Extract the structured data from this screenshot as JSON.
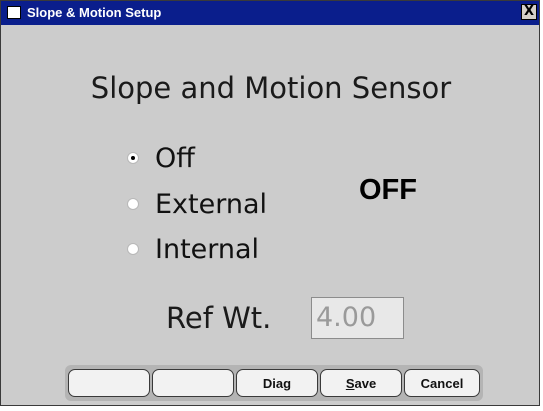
{
  "window": {
    "title": "Slope & Motion Setup",
    "close_label": "X"
  },
  "heading": "Slope and Motion Sensor",
  "options": [
    {
      "label": "Off",
      "checked": true
    },
    {
      "label": "External",
      "checked": false
    },
    {
      "label": "Internal",
      "checked": false
    }
  ],
  "status": "OFF",
  "ref_wt": {
    "label": "Ref Wt.",
    "value": "4.00"
  },
  "buttons": {
    "blank1": "",
    "blank2": "",
    "diag": "Diag",
    "save_underline": "S",
    "save_rest": "ave",
    "cancel": "Cancel"
  }
}
